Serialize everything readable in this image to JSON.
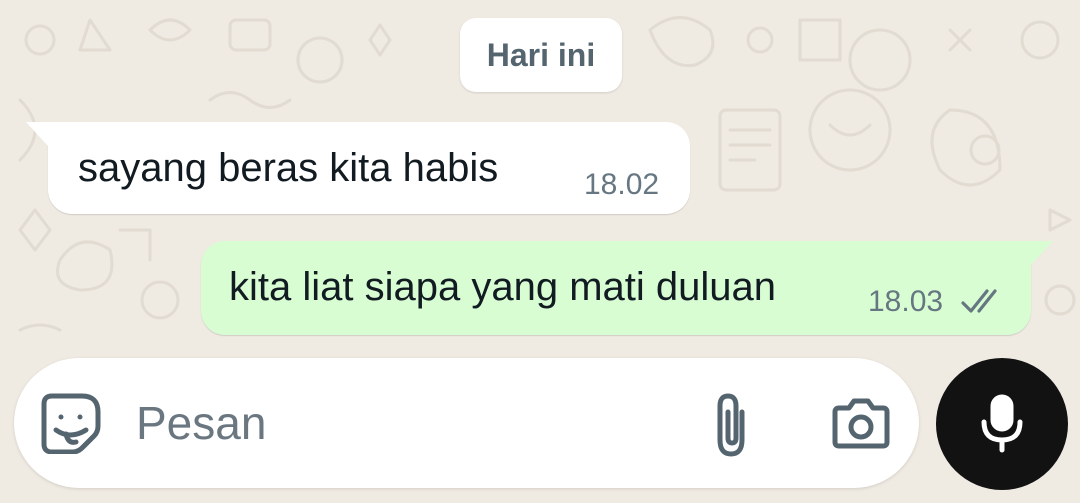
{
  "chat": {
    "date_label": "Hari ini",
    "messages": [
      {
        "direction": "incoming",
        "text": "sayang beras kita habis",
        "time": "18.02"
      },
      {
        "direction": "outgoing",
        "text": "kita liat siapa yang mati duluan",
        "time": "18.03",
        "status": "read"
      }
    ]
  },
  "composer": {
    "placeholder": "Pesan",
    "value": ""
  },
  "icons": {
    "sticker": "sticker-icon",
    "attach": "paperclip-icon",
    "camera": "camera-icon",
    "mic": "microphone-icon",
    "read_ticks": "double-check-icon"
  },
  "colors": {
    "wallpaper": "#efeae2",
    "incoming_bubble": "#ffffff",
    "outgoing_bubble": "#d9fdd3",
    "mic_button": "#121212",
    "text": "#111b21",
    "meta_text": "#667781",
    "icon": "#54656f"
  }
}
